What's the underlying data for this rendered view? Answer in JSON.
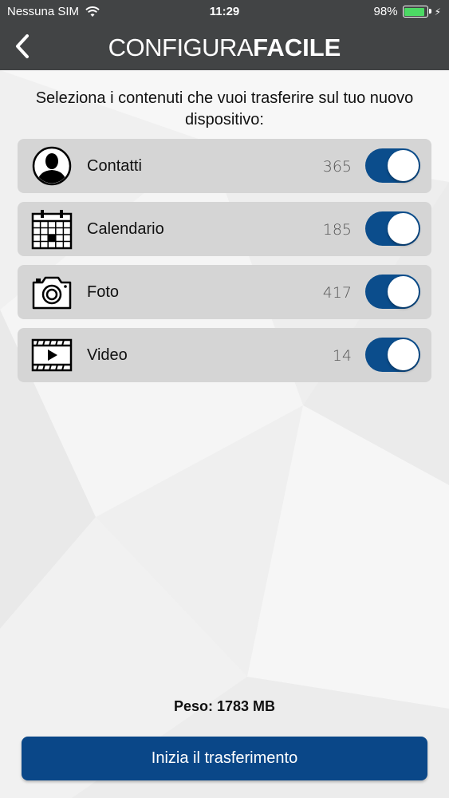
{
  "status_bar": {
    "carrier": "Nessuna SIM",
    "time": "11:29",
    "battery_percent": "98%",
    "battery_level": 0.98,
    "icons": {
      "wifi": "wifi-icon",
      "battery": "battery-icon",
      "charging": "bolt-icon"
    }
  },
  "nav": {
    "back_icon": "chevron-left-icon",
    "title_light": "CONFIGURA",
    "title_bold": "FACILE"
  },
  "intro_text": "Seleziona i contenuti che vuoi trasferire sul tuo nuovo dispositivo:",
  "items": [
    {
      "label": "Contatti",
      "count": "365",
      "icon": "contact-icon",
      "enabled": true
    },
    {
      "label": "Calendario",
      "count": "185",
      "icon": "calendar-icon",
      "enabled": true
    },
    {
      "label": "Foto",
      "count": "417",
      "icon": "camera-icon",
      "enabled": true
    },
    {
      "label": "Video",
      "count": "14",
      "icon": "video-icon",
      "enabled": true
    }
  ],
  "weight_text": "Peso: 1783 MB",
  "start_button": "Inizia il trasferimento",
  "colors": {
    "header": "#424445",
    "accent": "#0a4788",
    "toggle_on": "#0b4d8c",
    "row_bg": "#d5d5d5",
    "battery": "#4cd964"
  }
}
